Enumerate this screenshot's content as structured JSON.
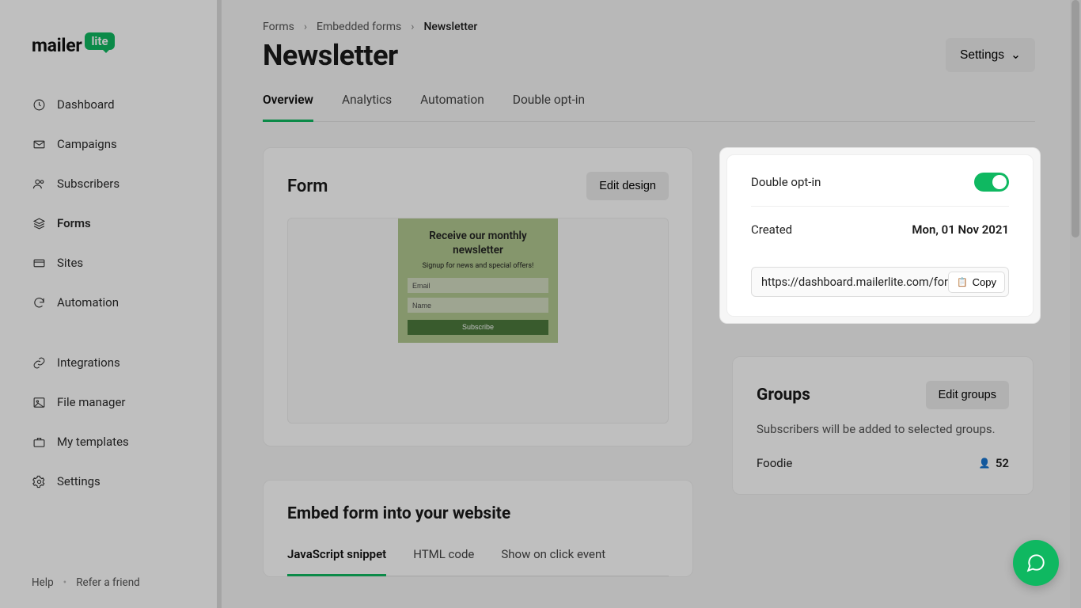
{
  "brand": {
    "word": "mailer",
    "badge": "lite"
  },
  "sidebar": {
    "items": [
      {
        "label": "Dashboard"
      },
      {
        "label": "Campaigns"
      },
      {
        "label": "Subscribers"
      },
      {
        "label": "Forms"
      },
      {
        "label": "Sites"
      },
      {
        "label": "Automation"
      },
      {
        "label": "Integrations"
      },
      {
        "label": "File manager"
      },
      {
        "label": "My templates"
      },
      {
        "label": "Settings"
      }
    ],
    "help": "Help",
    "refer": "Refer a friend"
  },
  "breadcrumb": {
    "forms": "Forms",
    "embedded": "Embedded forms",
    "current": "Newsletter"
  },
  "page": {
    "title": "Newsletter",
    "settings_btn": "Settings",
    "tabs": {
      "overview": "Overview",
      "analytics": "Analytics",
      "automation": "Automation",
      "doubleoptin": "Double opt-in"
    }
  },
  "form_card": {
    "heading": "Form",
    "edit_btn": "Edit design",
    "preview": {
      "title": "Receive our monthly newsletter",
      "subtitle": "Signup for news and special offers!",
      "email_ph": "Email",
      "name_ph": "Name",
      "submit": "Subscribe"
    }
  },
  "embed_card": {
    "heading": "Embed form into your website",
    "tabs": {
      "js": "JavaScript snippet",
      "html": "HTML code",
      "show": "Show on click event"
    }
  },
  "info_card": {
    "doubleoptin_label": "Double opt-in",
    "doubleoptin_on": true,
    "created_label": "Created",
    "created_value": "Mon, 01 Nov 2021",
    "url": "https://dashboard.mailerlite.com/forms/…",
    "copy": "Copy"
  },
  "groups_card": {
    "heading": "Groups",
    "edit_btn": "Edit groups",
    "description": "Subscribers will be added to selected groups.",
    "group_name": "Foodie",
    "group_count": "52"
  }
}
